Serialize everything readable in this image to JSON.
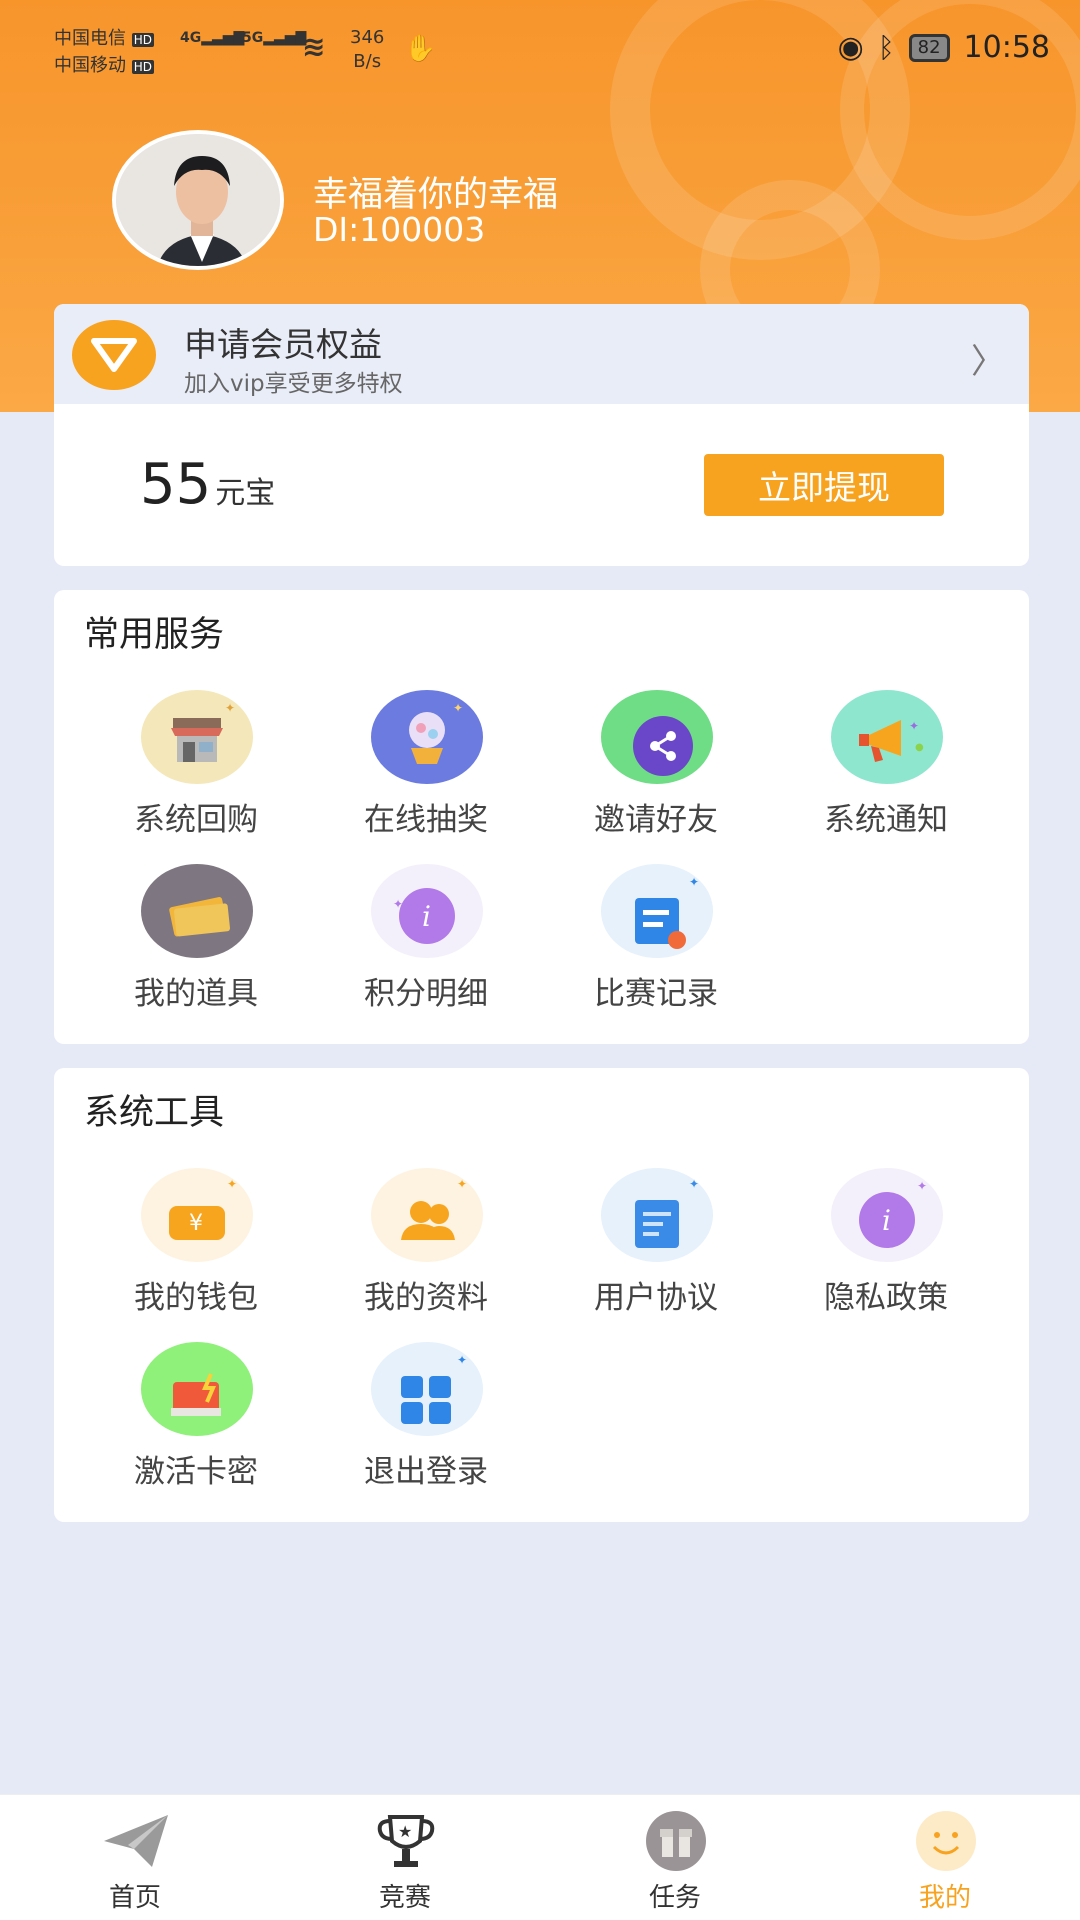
{
  "status_bar": {
    "carrier1": "中国电信",
    "carrier2": "中国移动",
    "hd": "HD",
    "net1": "4G",
    "net2": "5G",
    "speed": "346",
    "speed_unit": "B/s",
    "battery": "82",
    "time": "10:58"
  },
  "user": {
    "name": "幸福着你的幸福",
    "id": "DI:100003"
  },
  "vip": {
    "title": "申请会员权益",
    "subtitle": "加入vip享受更多特权",
    "arrow": "〉"
  },
  "balance": {
    "amount": "55",
    "unit": "元宝",
    "withdraw_label": "立即提现"
  },
  "common_services": {
    "title": "常用服务",
    "items": [
      {
        "label": "系统回购",
        "icon": "shop-icon"
      },
      {
        "label": "在线抽奖",
        "icon": "lottery-icon"
      },
      {
        "label": "邀请好友",
        "icon": "share-icon"
      },
      {
        "label": "系统通知",
        "icon": "megaphone-icon"
      },
      {
        "label": "我的道具",
        "icon": "tickets-icon"
      },
      {
        "label": "积分明细",
        "icon": "info-icon"
      },
      {
        "label": "比赛记录",
        "icon": "record-icon"
      }
    ]
  },
  "system_tools": {
    "title": "系统工具",
    "items": [
      {
        "label": "我的钱包",
        "icon": "wallet-icon"
      },
      {
        "label": "我的资料",
        "icon": "profile-icon"
      },
      {
        "label": "用户协议",
        "icon": "agreement-icon"
      },
      {
        "label": "隐私政策",
        "icon": "privacy-icon"
      },
      {
        "label": "激活卡密",
        "icon": "card-icon"
      },
      {
        "label": "退出登录",
        "icon": "logout-icon"
      }
    ]
  },
  "tabbar": {
    "tabs": [
      {
        "label": "首页",
        "icon": "paper-plane-icon"
      },
      {
        "label": "竞赛",
        "icon": "trophy-icon"
      },
      {
        "label": "任务",
        "icon": "gift-icon"
      },
      {
        "label": "我的",
        "icon": "smiley-icon"
      }
    ],
    "active_color": "#f8a320"
  },
  "colors": {
    "brand_orange": "#f8a320",
    "page_bg": "#e6eaf6"
  }
}
